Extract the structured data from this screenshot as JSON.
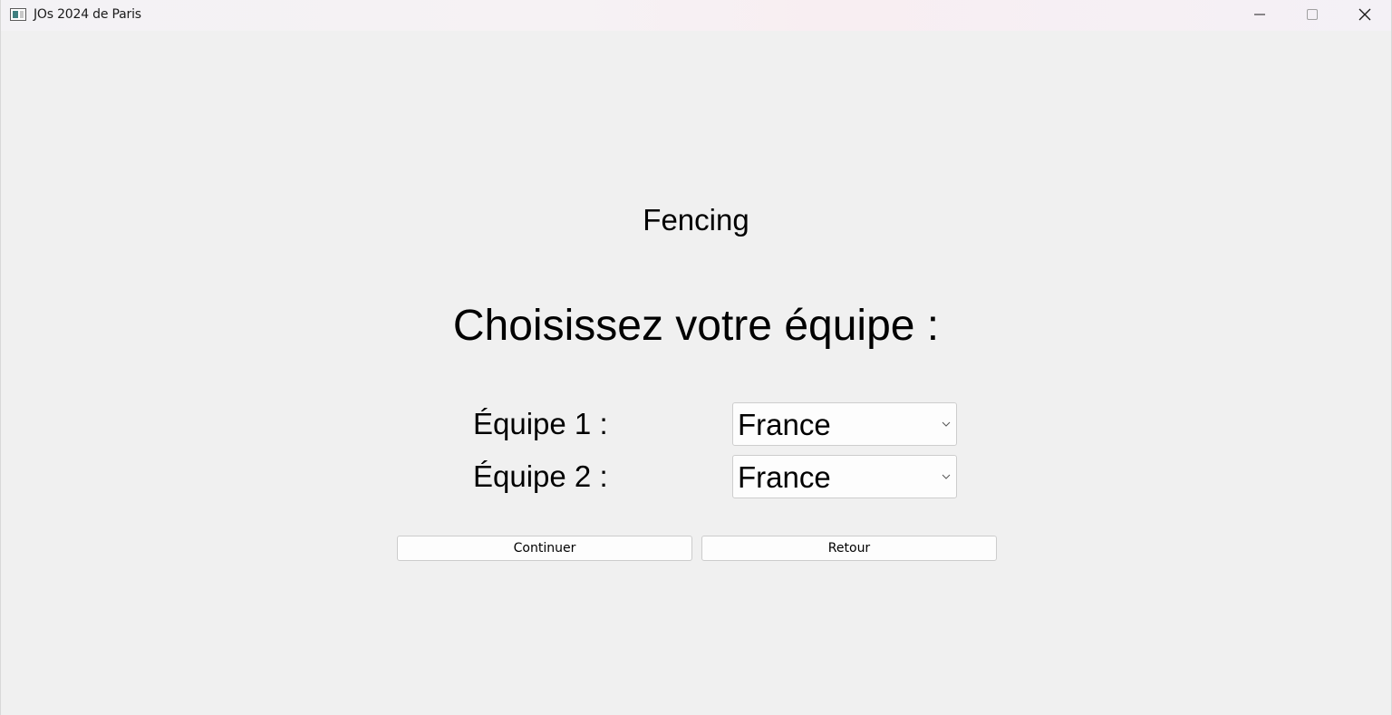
{
  "window": {
    "title": "JOs 2024 de Paris",
    "icons": {
      "app": "app-window-icon",
      "minimize": "minimize-icon",
      "maximize": "maximize-icon",
      "close": "close-icon"
    }
  },
  "main": {
    "sport": "Fencing",
    "prompt": "Choisissez votre équipe :",
    "team1": {
      "label": "Équipe 1 :",
      "selected": "France"
    },
    "team2": {
      "label": "Équipe 2 :",
      "selected": "France"
    },
    "buttons": {
      "continue": "Continuer",
      "back": "Retour"
    }
  }
}
